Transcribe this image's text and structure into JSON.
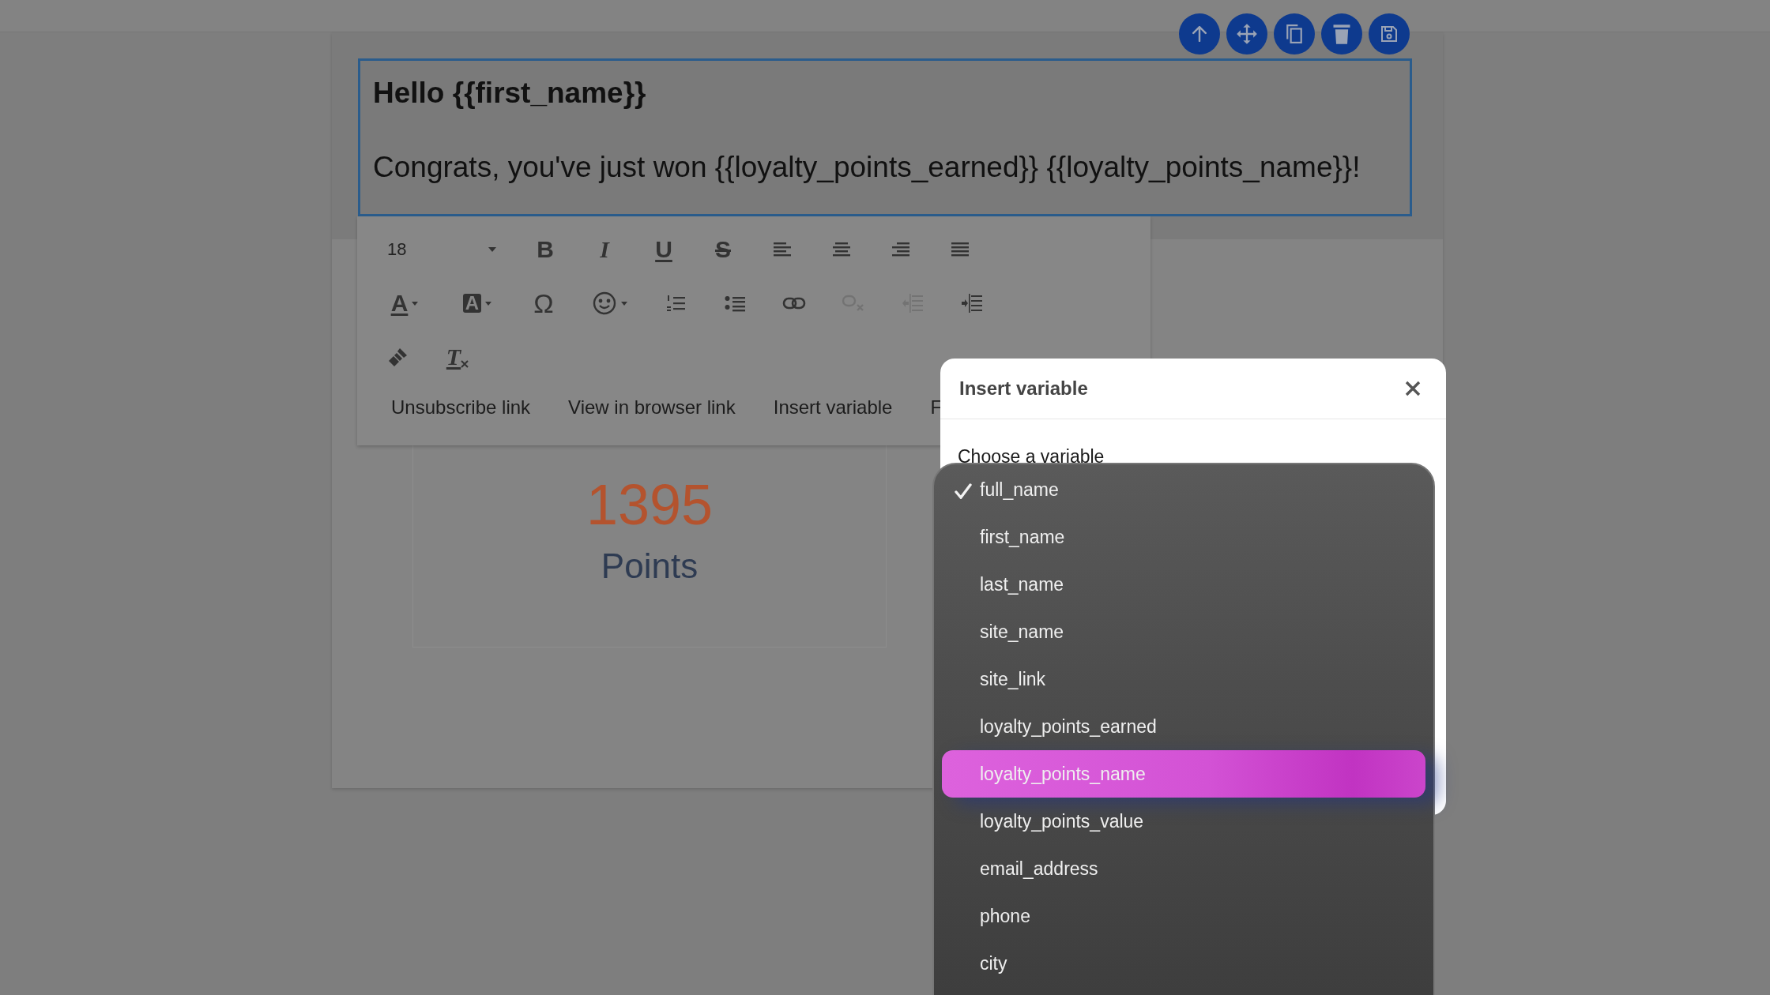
{
  "editor": {
    "heading": "Hello {{first_name}}",
    "body": "Congrats, you've just won {{loyalty_points_earned}} {{loyalty_points_name}}!"
  },
  "toolbar": {
    "font_size": "18",
    "rows": [
      {
        "tools": [
          {
            "kind": "bold",
            "glyph": "B",
            "disabled": false
          },
          {
            "kind": "italic",
            "glyph": "I",
            "disabled": false
          },
          {
            "kind": "underline",
            "glyph": "U",
            "disabled": false
          },
          {
            "kind": "strike",
            "glyph": "S",
            "disabled": false
          },
          {
            "kind": "align-left",
            "disabled": false
          },
          {
            "kind": "align-center",
            "disabled": false
          },
          {
            "kind": "align-right",
            "disabled": false
          },
          {
            "kind": "justify",
            "disabled": false
          }
        ]
      },
      {
        "tools": [
          {
            "kind": "text-color",
            "glyph": "A",
            "disabled": false
          },
          {
            "kind": "highlight",
            "glyph": "A",
            "disabled": false
          },
          {
            "kind": "special-char",
            "glyph": "Ω",
            "disabled": false
          },
          {
            "kind": "emoji",
            "disabled": false
          },
          {
            "kind": "ordered-list",
            "disabled": false
          },
          {
            "kind": "bullet-list",
            "disabled": false
          },
          {
            "kind": "link",
            "disabled": false
          },
          {
            "kind": "unlink",
            "disabled": true
          },
          {
            "kind": "outdent",
            "disabled": true
          },
          {
            "kind": "indent",
            "disabled": false
          }
        ]
      },
      {
        "tools": [
          {
            "kind": "format-painter",
            "disabled": false
          },
          {
            "kind": "clear-format",
            "glyph": "T",
            "disabled": false
          }
        ]
      }
    ],
    "links": [
      "Unsubscribe link",
      "View in browser link",
      "Insert variable",
      "F"
    ]
  },
  "points_card": {
    "value": "1395",
    "label": "Points"
  },
  "dialog": {
    "title": "Insert variable",
    "label": "Choose a variable",
    "options": [
      {
        "label": "full_name",
        "selected": true,
        "highlighted": false
      },
      {
        "label": "first_name",
        "selected": false,
        "highlighted": false
      },
      {
        "label": "last_name",
        "selected": false,
        "highlighted": false
      },
      {
        "label": "site_name",
        "selected": false,
        "highlighted": false
      },
      {
        "label": "site_link",
        "selected": false,
        "highlighted": false
      },
      {
        "label": "loyalty_points_earned",
        "selected": false,
        "highlighted": false
      },
      {
        "label": "loyalty_points_name",
        "selected": false,
        "highlighted": true
      },
      {
        "label": "loyalty_points_value",
        "selected": false,
        "highlighted": false
      },
      {
        "label": "email_address",
        "selected": false,
        "highlighted": false
      },
      {
        "label": "phone",
        "selected": false,
        "highlighted": false
      },
      {
        "label": "city",
        "selected": false,
        "highlighted": false
      }
    ]
  }
}
